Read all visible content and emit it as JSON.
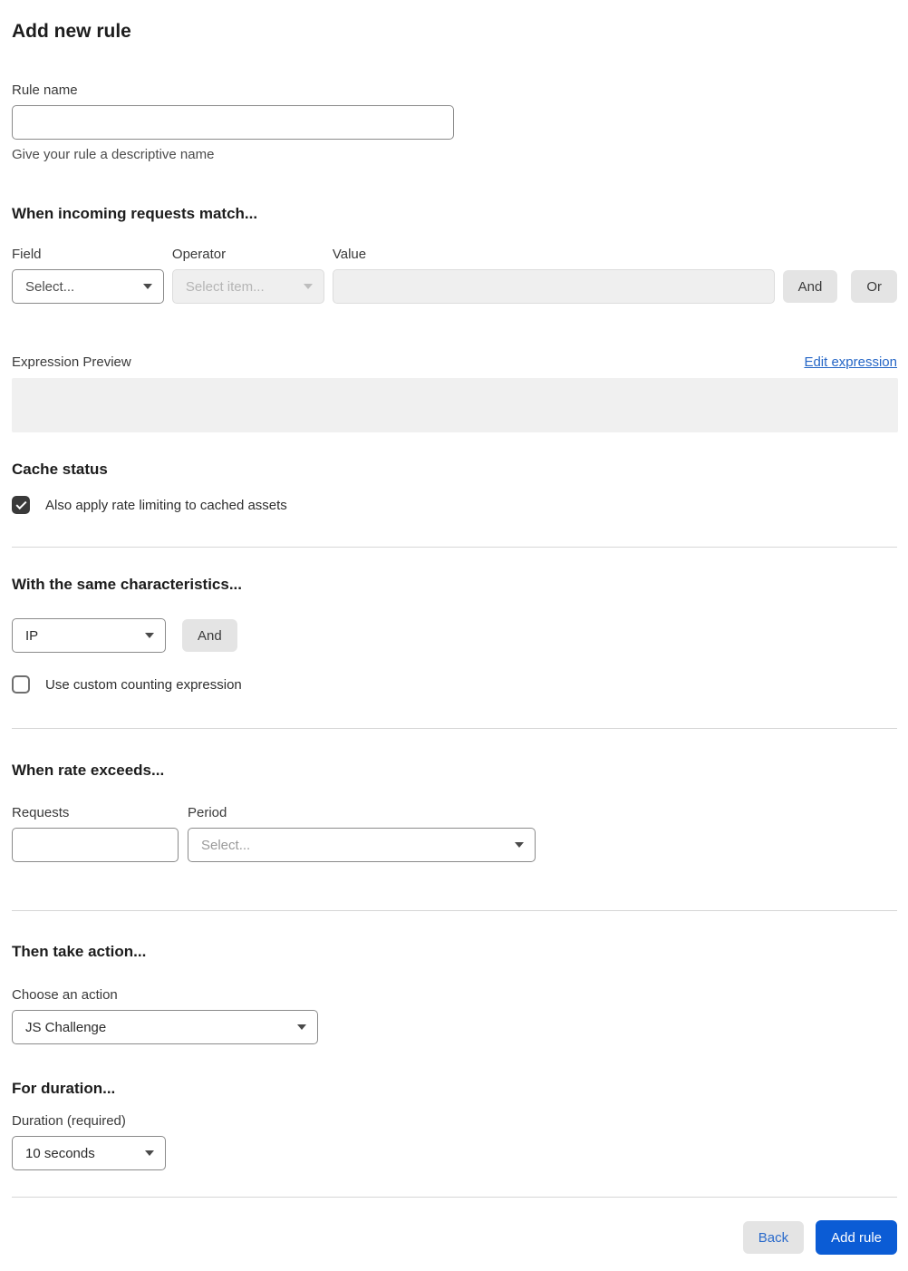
{
  "page": {
    "title": "Add new rule"
  },
  "colors": {
    "accent_blue": "#0b5cd5",
    "link_blue": "#2566c6",
    "back_text_blue": "#2b6bcb",
    "button_gray": "#e4e4e4",
    "disabled_bg": "#efefef",
    "expression_box_bg": "#f0f0f0",
    "divider": "#d6d6d6",
    "checkbox_checked": "#3a3a3a"
  },
  "rule_name": {
    "label": "Rule name",
    "value": "",
    "helper": "Give your rule a descriptive name"
  },
  "match": {
    "heading": "When incoming requests match...",
    "field": {
      "label": "Field",
      "value": "Select..."
    },
    "operator": {
      "label": "Operator",
      "value": "Select item...",
      "disabled": true
    },
    "value": {
      "label": "Value",
      "value": "",
      "disabled": true
    },
    "and_label": "And",
    "or_label": "Or",
    "expression_preview_label": "Expression Preview",
    "edit_expression_label": "Edit expression",
    "expression_value": ""
  },
  "cache": {
    "heading": "Cache status",
    "checkbox_label": "Also apply rate limiting to cached assets",
    "checked": true
  },
  "characteristics": {
    "heading": "With the same characteristics...",
    "select_value": "IP",
    "and_label": "And",
    "custom_label": "Use custom counting expression",
    "custom_checked": false
  },
  "rate": {
    "heading": "When rate exceeds...",
    "requests_label": "Requests",
    "requests_value": "",
    "period_label": "Period",
    "period_value": "Select..."
  },
  "action": {
    "heading": "Then take action...",
    "label": "Choose an action",
    "value": "JS Challenge"
  },
  "duration": {
    "heading": "For duration...",
    "label": "Duration (required)",
    "value": "10 seconds"
  },
  "footer": {
    "back_label": "Back",
    "submit_label": "Add rule"
  }
}
